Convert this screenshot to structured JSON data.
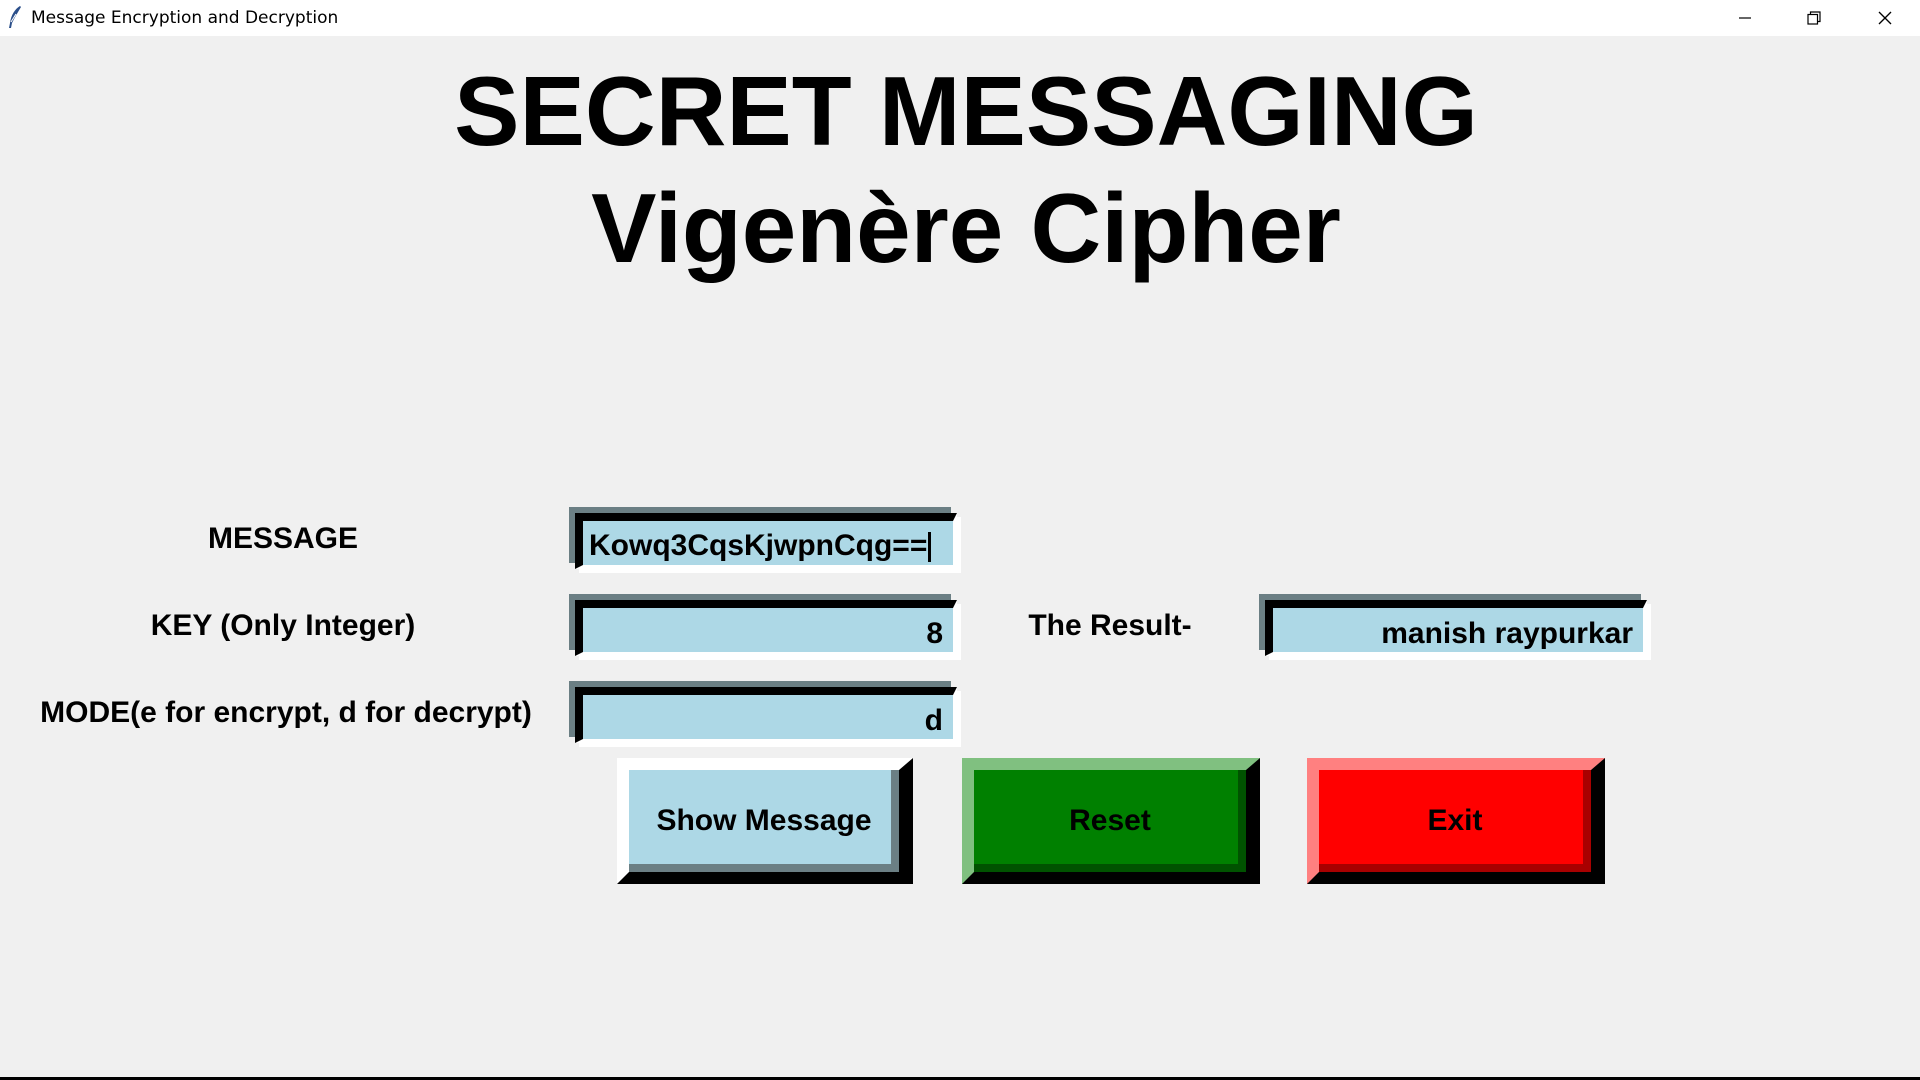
{
  "window": {
    "title": "Message Encryption and Decryption",
    "app_icon": "feather-icon",
    "controls": [
      "minimize-icon",
      "restore-icon",
      "close-icon"
    ]
  },
  "header": {
    "title": "SECRET MESSAGING",
    "subtitle": "Vigenère Cipher"
  },
  "form": {
    "message_label": "MESSAGE",
    "message_value": "Kowq3CqsKjwpnCqg==",
    "key_label": "KEY (Only Integer)",
    "key_value": "8",
    "mode_label": "MODE(e for encrypt, d for decrypt)",
    "mode_value": "d",
    "result_label": "The Result-",
    "result_value": "manish raypurkar"
  },
  "buttons": {
    "show_label": "Show Message",
    "reset_label": "Reset",
    "exit_label": "Exit"
  },
  "colors": {
    "background": "#f0f0f0",
    "entry_bg": "#add8e6",
    "show_button": "#add8e6",
    "reset_button": "#008000",
    "exit_button": "#ff0000"
  }
}
